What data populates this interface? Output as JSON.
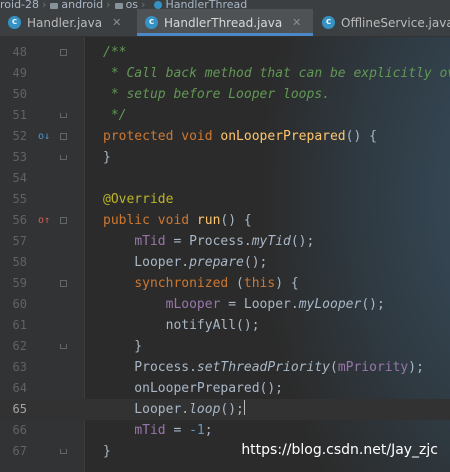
{
  "breadcrumb": [
    "roid-28",
    "android",
    "os",
    "HandlerThread"
  ],
  "tabs": [
    {
      "label": "Handler.java",
      "active": false
    },
    {
      "label": "HandlerThread.java",
      "active": true
    },
    {
      "label": "OfflineService.java",
      "active": false
    }
  ],
  "lines": [
    {
      "num": "48",
      "code": [
        {
          "k": "c",
          "t": "/**"
        }
      ]
    },
    {
      "num": "49",
      "code": [
        {
          "k": "c",
          "t": " * Call back method that can be explicitly overridden if needed to execute some"
        }
      ]
    },
    {
      "num": "50",
      "code": [
        {
          "k": "c",
          "t": " * setup before Looper loops."
        }
      ]
    },
    {
      "num": "51",
      "code": [
        {
          "k": "c",
          "t": " */"
        }
      ]
    },
    {
      "num": "52",
      "code": [
        {
          "k": "k",
          "t": "protected void "
        },
        {
          "k": "m",
          "t": "onLooperPrepared"
        },
        {
          "k": "t",
          "t": "() {"
        }
      ]
    },
    {
      "num": "53",
      "code": [
        {
          "k": "t",
          "t": "}"
        }
      ]
    },
    {
      "num": "54",
      "code": []
    },
    {
      "num": "55",
      "code": [
        {
          "k": "a",
          "t": "@Override"
        }
      ]
    },
    {
      "num": "56",
      "code": [
        {
          "k": "k",
          "t": "public void "
        },
        {
          "k": "m",
          "t": "run"
        },
        {
          "k": "t",
          "t": "() {"
        }
      ]
    },
    {
      "num": "57",
      "code": [
        {
          "k": "t",
          "t": "    "
        },
        {
          "k": "f",
          "t": "mTid"
        },
        {
          "k": "t",
          "t": " = Process."
        },
        {
          "k": "i",
          "t": "myTid"
        },
        {
          "k": "t",
          "t": "();"
        }
      ]
    },
    {
      "num": "58",
      "code": [
        {
          "k": "t",
          "t": "    Looper."
        },
        {
          "k": "i",
          "t": "prepare"
        },
        {
          "k": "t",
          "t": "();"
        }
      ]
    },
    {
      "num": "59",
      "code": [
        {
          "k": "t",
          "t": "    "
        },
        {
          "k": "k",
          "t": "synchronized"
        },
        {
          "k": "t",
          "t": " ("
        },
        {
          "k": "k",
          "t": "this"
        },
        {
          "k": "t",
          "t": ") {"
        }
      ]
    },
    {
      "num": "60",
      "code": [
        {
          "k": "t",
          "t": "        "
        },
        {
          "k": "f",
          "t": "mLooper"
        },
        {
          "k": "t",
          "t": " = Looper."
        },
        {
          "k": "i",
          "t": "myLooper"
        },
        {
          "k": "t",
          "t": "();"
        }
      ]
    },
    {
      "num": "61",
      "code": [
        {
          "k": "t",
          "t": "        notifyAll();"
        }
      ]
    },
    {
      "num": "62",
      "code": [
        {
          "k": "t",
          "t": "    }"
        }
      ]
    },
    {
      "num": "63",
      "code": [
        {
          "k": "t",
          "t": "    Process."
        },
        {
          "k": "i",
          "t": "setThreadPriority"
        },
        {
          "k": "t",
          "t": "("
        },
        {
          "k": "f",
          "t": "mPriority"
        },
        {
          "k": "t",
          "t": ");"
        }
      ]
    },
    {
      "num": "64",
      "code": [
        {
          "k": "t",
          "t": "    onLooperPrepared();"
        }
      ]
    },
    {
      "num": "65",
      "code": [
        {
          "k": "t",
          "t": "    Looper."
        },
        {
          "k": "i",
          "t": "loop"
        },
        {
          "k": "t",
          "t": "();"
        }
      ],
      "current": true
    },
    {
      "num": "66",
      "code": [
        {
          "k": "t",
          "t": "    "
        },
        {
          "k": "f",
          "t": "mTid"
        },
        {
          "k": "t",
          "t": " = "
        },
        {
          "k": "n",
          "t": "-1"
        },
        {
          "k": "t",
          "t": ";"
        }
      ]
    },
    {
      "num": "67",
      "code": [
        {
          "k": "t",
          "t": "}"
        }
      ]
    }
  ],
  "watermark": "https://blog.csdn.net/Jay_zjc"
}
